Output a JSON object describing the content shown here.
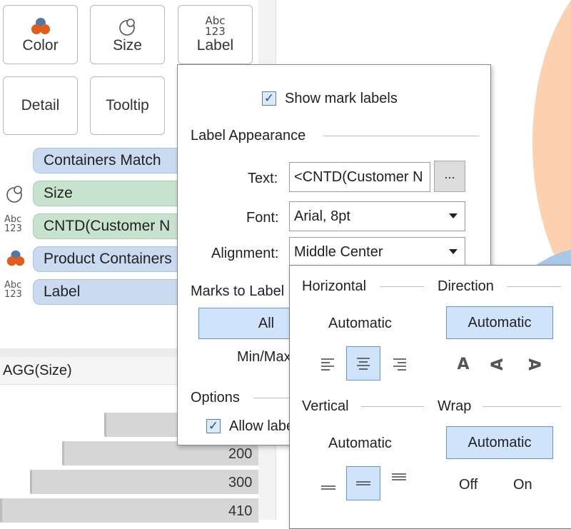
{
  "marks": {
    "color_label": "Color",
    "size_label": "Size",
    "label_label": "Label",
    "label_icon_top": "Abc",
    "label_icon_bottom": "123",
    "detail_label": "Detail",
    "tooltip_label": "Tooltip"
  },
  "shelf": [
    {
      "text": "Containers Match",
      "type": "blue",
      "icon": "none"
    },
    {
      "text": "Size",
      "type": "green",
      "icon": "size-icon"
    },
    {
      "text": "CNTD(Customer N",
      "type": "green",
      "icon": "label-icon"
    },
    {
      "text": "Product Containers",
      "type": "blue",
      "icon": "color-icon"
    },
    {
      "text": "Label",
      "type": "blue",
      "icon": "label-icon"
    }
  ],
  "abc": "Abc",
  "n123": "123",
  "axis_header": "AGG(Size)",
  "bars": [
    {
      "value": 0.55,
      "label": ""
    },
    {
      "value": 0.6,
      "label": "200"
    },
    {
      "value": 0.72,
      "label": "300"
    },
    {
      "value": 1.0,
      "label": "410"
    }
  ],
  "label_popup": {
    "show_mark_labels": "Show mark labels",
    "appearance_heading": "Label Appearance",
    "text_label": "Text:",
    "text_value": "<CNTD(Customer N",
    "ellipsis": "...",
    "font_label": "Font:",
    "font_value": "Arial, 8pt",
    "alignment_label": "Alignment:",
    "alignment_value": "Middle Center",
    "marks_to_label": "Marks to Label",
    "all_button": "All",
    "minmax": "Min/Max",
    "options_heading": "Options",
    "allow_labels": "Allow labe"
  },
  "alignment_popup": {
    "horizontal_heading": "Horizontal",
    "direction_heading": "Direction",
    "vertical_heading": "Vertical",
    "wrap_heading": "Wrap",
    "h_automatic": "Automatic",
    "dir_automatic": "Automatic",
    "v_automatic": "Automatic",
    "wrap_automatic": "Automatic",
    "wrap_off": "Off",
    "wrap_on": "On"
  },
  "colors": {
    "pill_blue": "#c9daf1",
    "pill_green": "#c8e3cd",
    "selected_fill": "#cfe4fb",
    "selected_border": "#5c9ad8",
    "viz_orange": "#fbd1b0",
    "viz_blue": "#a9c8e8"
  }
}
